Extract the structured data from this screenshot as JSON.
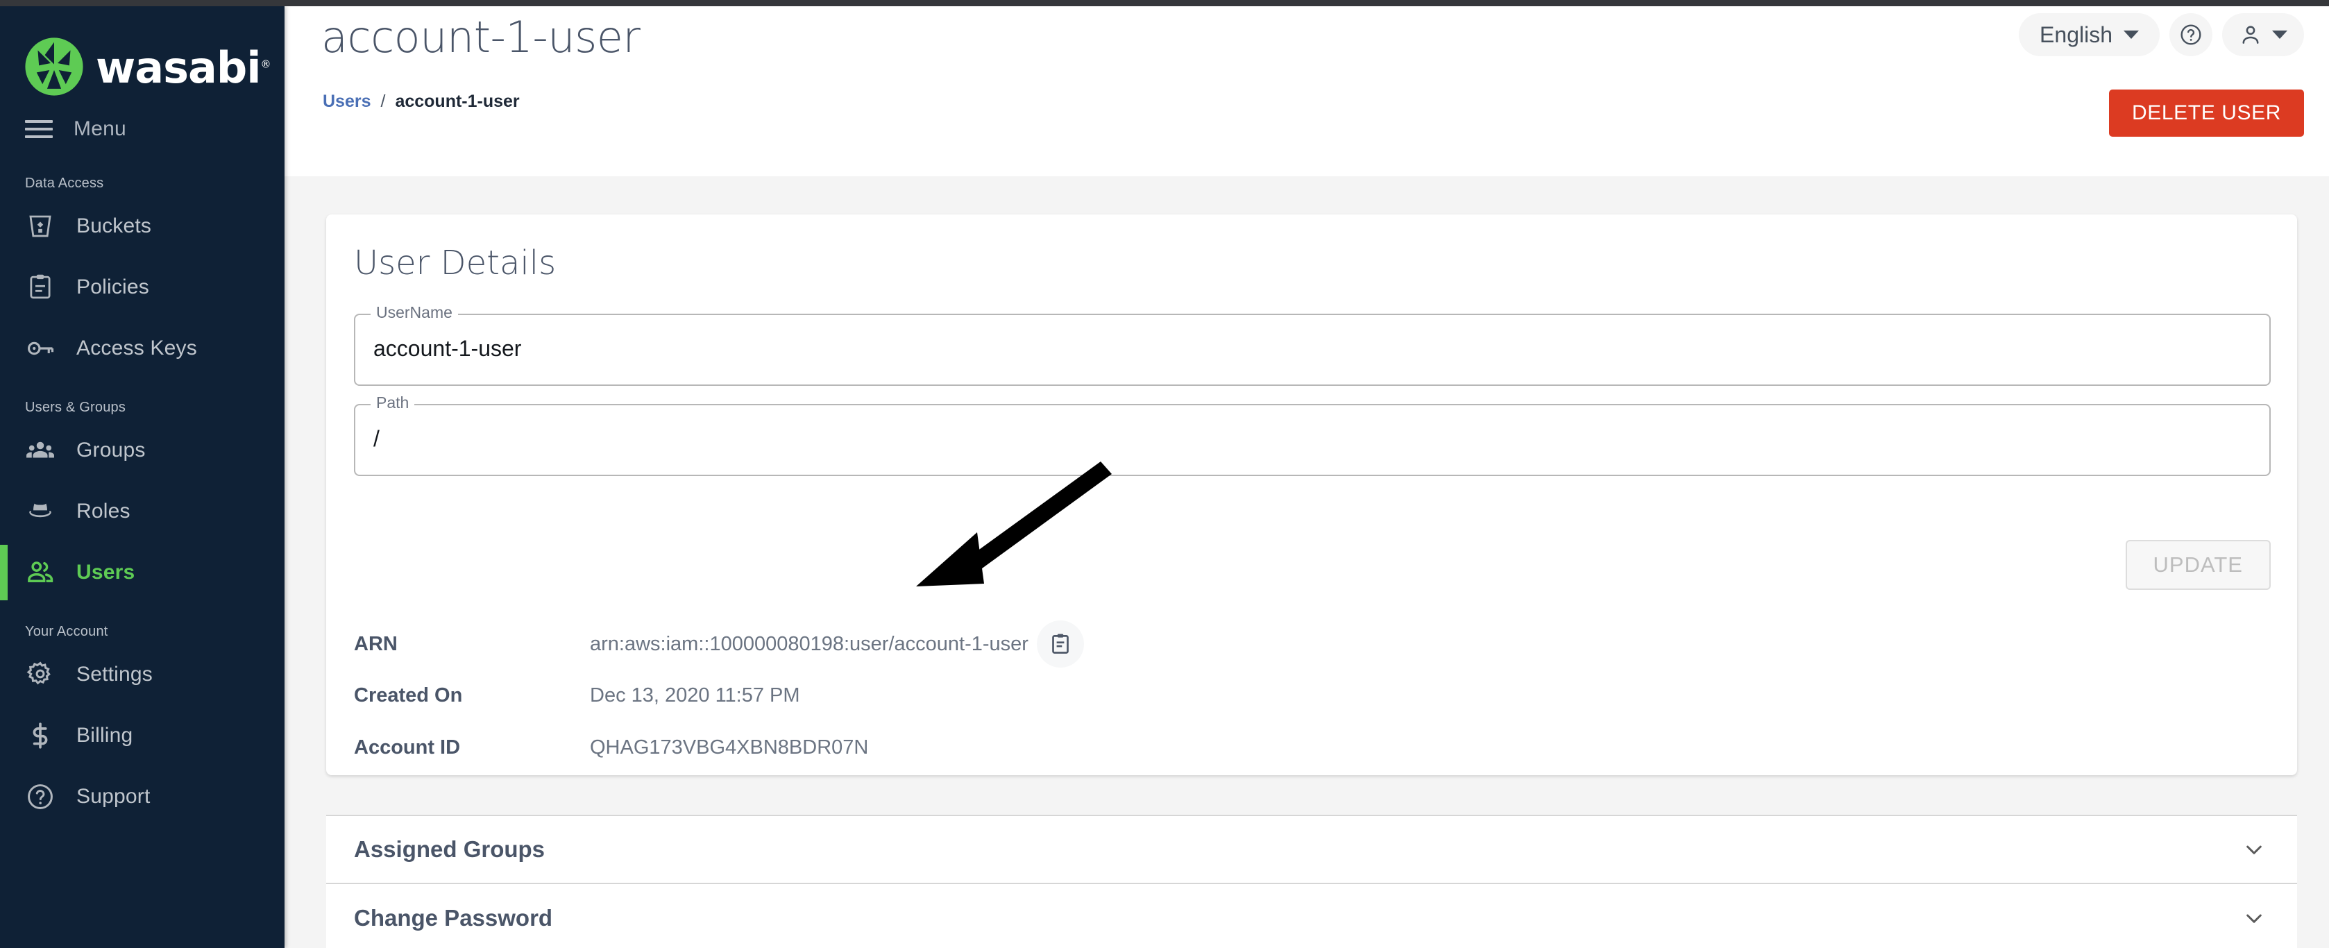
{
  "brand": {
    "name": "wasabi",
    "trademark": "®",
    "logo_icon": "wasabi-leaf-logo",
    "accent_color": "#5ecb54",
    "sidebar_bg": "#0f2136"
  },
  "sidebar": {
    "menu_label": "Menu",
    "menu_icon": "hamburger-icon",
    "groups": [
      {
        "title": "Data Access",
        "items": [
          {
            "label": "Buckets",
            "icon": "bucket-icon",
            "active": false
          },
          {
            "label": "Policies",
            "icon": "clipboard-icon",
            "active": false
          },
          {
            "label": "Access Keys",
            "icon": "key-icon",
            "active": false
          }
        ]
      },
      {
        "title": "Users & Groups",
        "items": [
          {
            "label": "Groups",
            "icon": "groups-icon",
            "active": false
          },
          {
            "label": "Roles",
            "icon": "hat-icon",
            "active": false
          },
          {
            "label": "Users",
            "icon": "user-pair-icon",
            "active": true
          }
        ]
      },
      {
        "title": "Your Account",
        "items": [
          {
            "label": "Settings",
            "icon": "gear-icon",
            "active": false
          },
          {
            "label": "Billing",
            "icon": "dollar-icon",
            "active": false
          },
          {
            "label": "Support",
            "icon": "question-circle-icon",
            "active": false
          }
        ]
      }
    ]
  },
  "header": {
    "title": "account-1-user",
    "breadcrumb": {
      "parent": "Users",
      "separator": "/",
      "current": "account-1-user"
    },
    "language": {
      "label": "English",
      "caret_icon": "chevron-down-icon"
    },
    "help_icon": "question-circle-icon",
    "account_icon": "person-icon",
    "account_caret_icon": "chevron-down-icon",
    "delete_button": "DELETE USER",
    "delete_button_color": "#dc3b22"
  },
  "user_details": {
    "card_title": "User Details",
    "fields": [
      {
        "legend": "UserName",
        "value": "account-1-user",
        "placeholder": "UserName"
      },
      {
        "legend": "Path",
        "value": "/",
        "placeholder": "Path"
      }
    ],
    "update_button": "UPDATE",
    "info_rows": [
      {
        "label": "ARN",
        "value": "arn:aws:iam::100000080198:user/account-1-user",
        "copy_icon": "clipboard-copy-icon"
      },
      {
        "label": "Created On",
        "value": "Dec 13, 2020 11:57 PM"
      },
      {
        "label": "Account ID",
        "value": "QHAG173VBG4XBN8BDR07N"
      }
    ]
  },
  "accordions": [
    {
      "title": "Assigned Groups",
      "chevron_icon": "chevron-down-icon",
      "expanded": false
    },
    {
      "title": "Change Password",
      "chevron_icon": "chevron-down-icon",
      "expanded": false
    }
  ],
  "annotation": {
    "type": "arrow",
    "description": "black arrow pointing down-left toward the ARN value"
  }
}
